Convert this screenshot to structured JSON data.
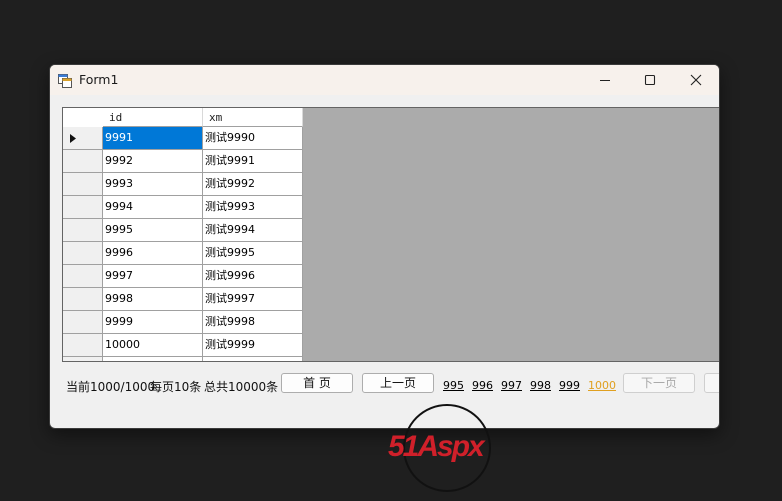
{
  "window": {
    "title": "Form1",
    "accent": "#0078d7"
  },
  "grid": {
    "columns": [
      "id",
      "xm"
    ],
    "rows": [
      {
        "id": "9991",
        "xm": "测试9990"
      },
      {
        "id": "9992",
        "xm": "测试9991"
      },
      {
        "id": "9993",
        "xm": "测试9992"
      },
      {
        "id": "9994",
        "xm": "测试9993"
      },
      {
        "id": "9995",
        "xm": "测试9994"
      },
      {
        "id": "9996",
        "xm": "测试9995"
      },
      {
        "id": "9997",
        "xm": "测试9996"
      },
      {
        "id": "9998",
        "xm": "测试9997"
      },
      {
        "id": "9999",
        "xm": "测试9998"
      },
      {
        "id": "10000",
        "xm": "测试9999"
      }
    ],
    "selected_row": 0
  },
  "pager": {
    "current_info": "当前1000/1000",
    "per_page_info": "每页10条",
    "total_info": "总共10000条",
    "first_label": "首 页",
    "prev_label": "上一页",
    "pages": [
      "995",
      "996",
      "997",
      "998",
      "999",
      "1000"
    ],
    "current_page": "1000",
    "next_label": "下一页"
  },
  "watermark": {
    "text": "51Aspx"
  },
  "icons": [
    "form-app-icon",
    "minimize-icon",
    "maximize-icon",
    "close-icon",
    "row-pointer-icon"
  ]
}
